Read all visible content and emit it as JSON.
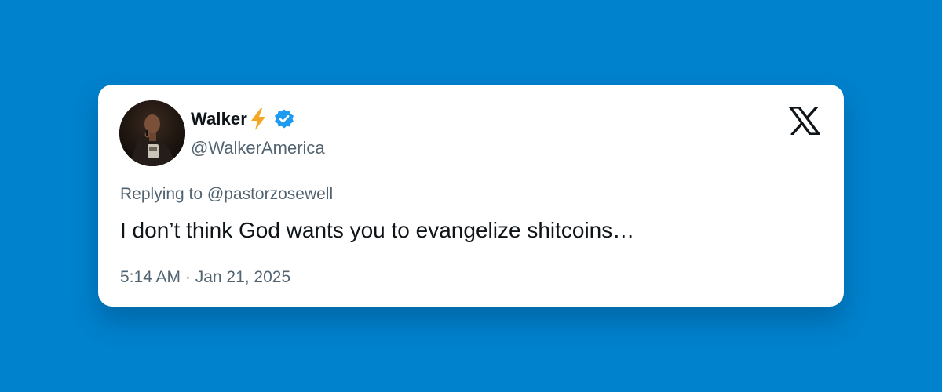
{
  "background_color": "#0082cd",
  "tweet": {
    "display_name": "Walker",
    "name_emoji": "lightning-bolt-icon",
    "verified_icon": "verified-badge-icon",
    "handle": "@WalkerAmerica",
    "reply_prefix": "Replying to ",
    "reply_to": "@pastorzosewell",
    "text": "I don’t think God wants you to evangelize shitcoins…",
    "timestamp": "5:14 AM · Jan 21, 2025",
    "brand_icon": "x-logo-icon",
    "verified_color": "#1d9bf0",
    "secondary_text_color": "#536471",
    "primary_text_color": "#0f1419"
  }
}
